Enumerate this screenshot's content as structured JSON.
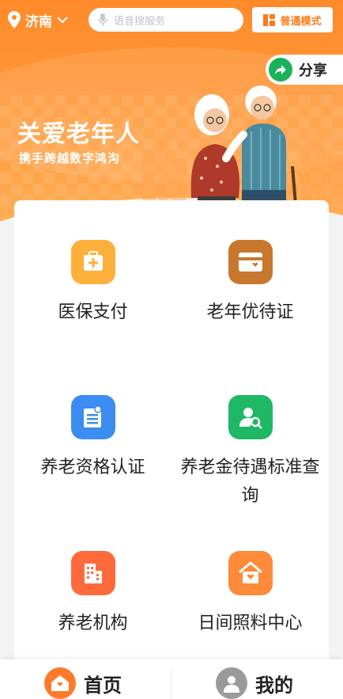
{
  "header": {
    "city": "济南",
    "search_placeholder": "语音搜服务",
    "mode_label": "普通模式"
  },
  "share_label": "分享",
  "banner": {
    "title": "关爱老年人",
    "subtitle": "携手跨越数字鸿沟"
  },
  "services": [
    {
      "label": "医保支付",
      "icon": "medical-insurance-icon",
      "color": "#ffb03a"
    },
    {
      "label": "老年优待证",
      "icon": "card-icon",
      "color": "#c8782e"
    },
    {
      "label": "养老资格认证",
      "icon": "document-icon",
      "color": "#3b8df2"
    },
    {
      "label": "养老金待遇标准查询",
      "icon": "user-search-icon",
      "color": "#1fb864"
    },
    {
      "label": "养老机构",
      "icon": "building-icon",
      "color": "#ff6a3d"
    },
    {
      "label": "日间照料中心",
      "icon": "care-home-icon",
      "color": "#ff8a3a"
    }
  ],
  "nav": {
    "home": "首页",
    "mine": "我的"
  },
  "colors": {
    "brand_orange": "#ff8a2a",
    "share_green": "#19b25a"
  }
}
